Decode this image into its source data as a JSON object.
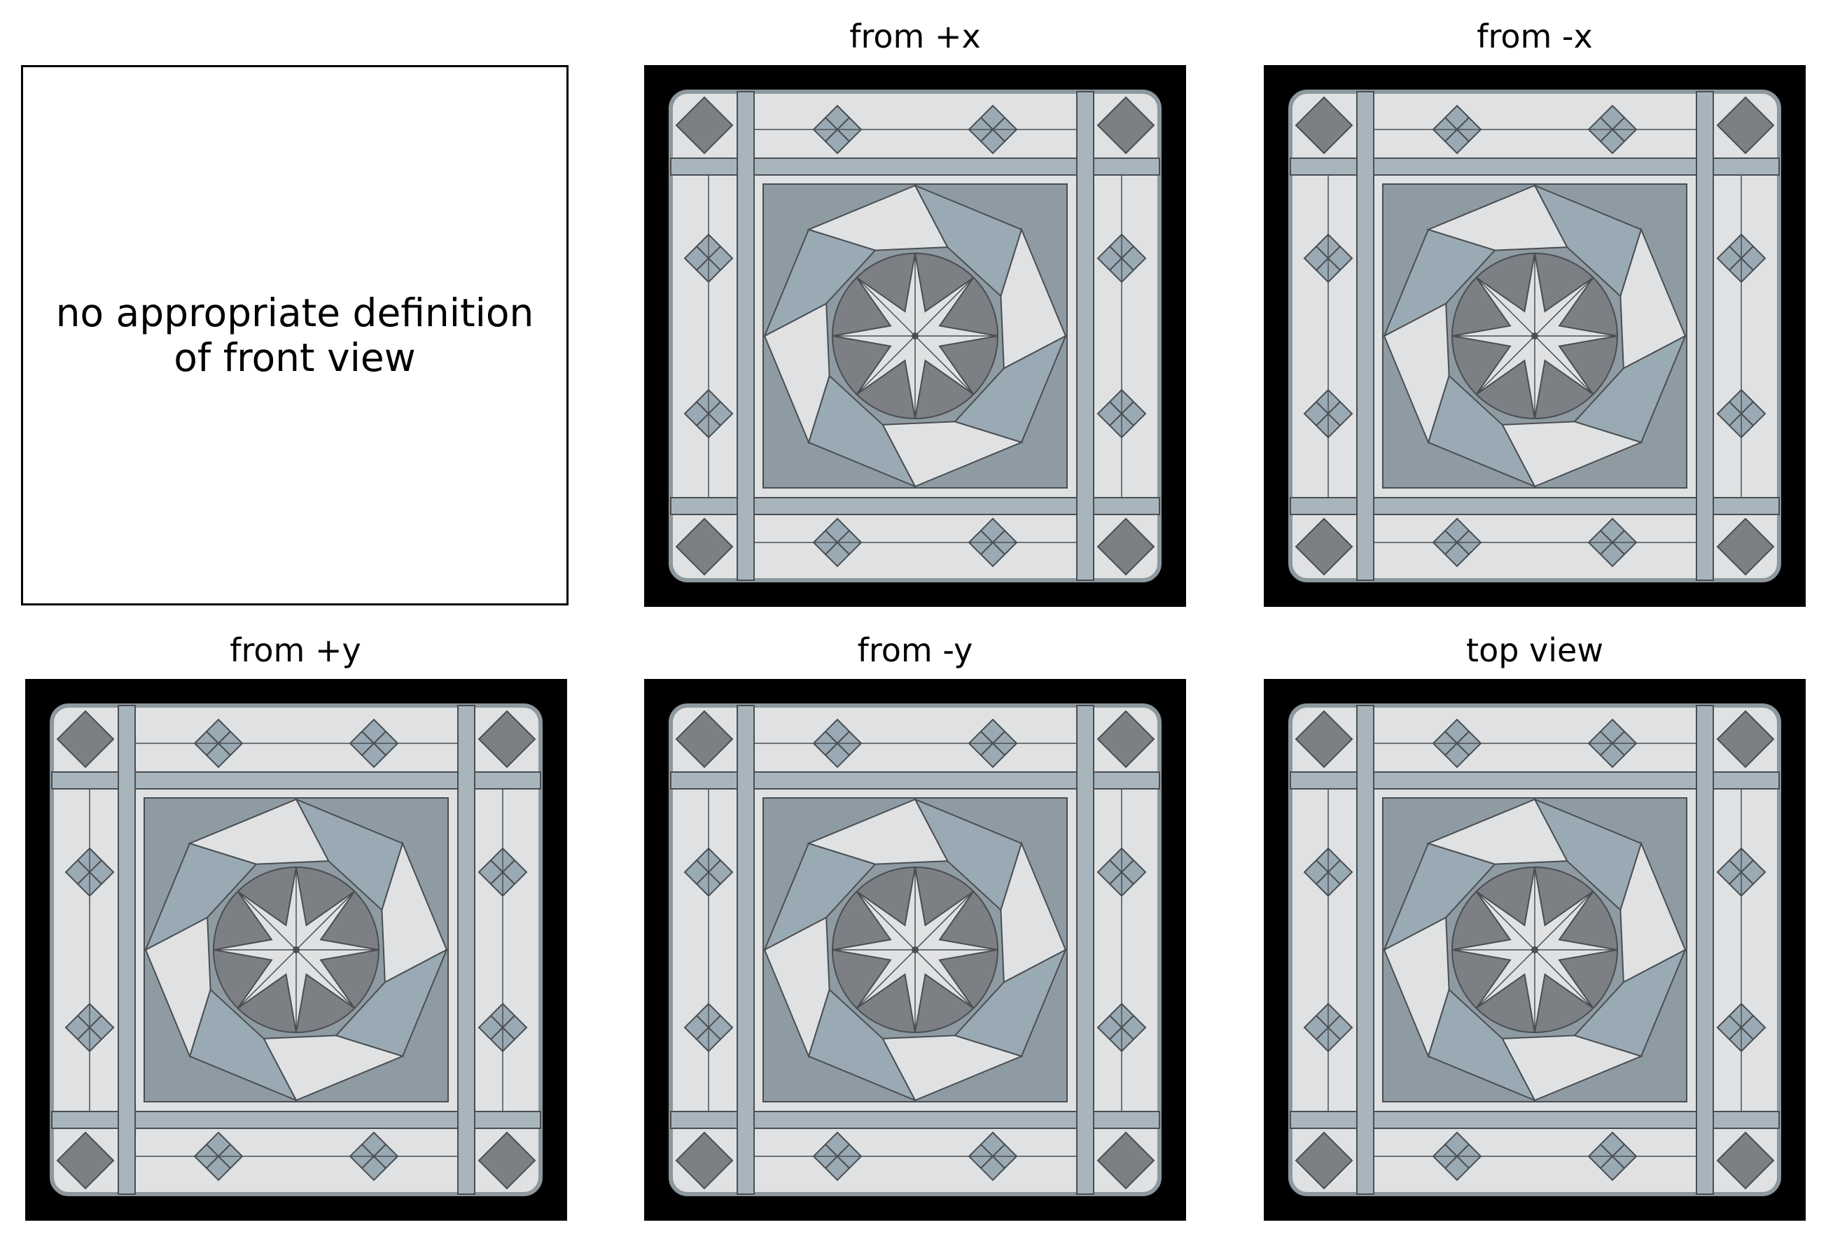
{
  "front_view": {
    "message": "no appropriate definition\nof front view"
  },
  "views": [
    {
      "title": "from +x"
    },
    {
      "title": "from -x"
    },
    {
      "title": "from +y"
    },
    {
      "title": "from -y"
    },
    {
      "title": "top view"
    }
  ],
  "colors": {
    "background": "#000000",
    "tile_light": "#dfe1e2",
    "tile_mid": "#a9b5bd",
    "tile_blue": "#9aaab4",
    "tile_dark": "#7c7f83",
    "lead": "#4a4e52"
  }
}
